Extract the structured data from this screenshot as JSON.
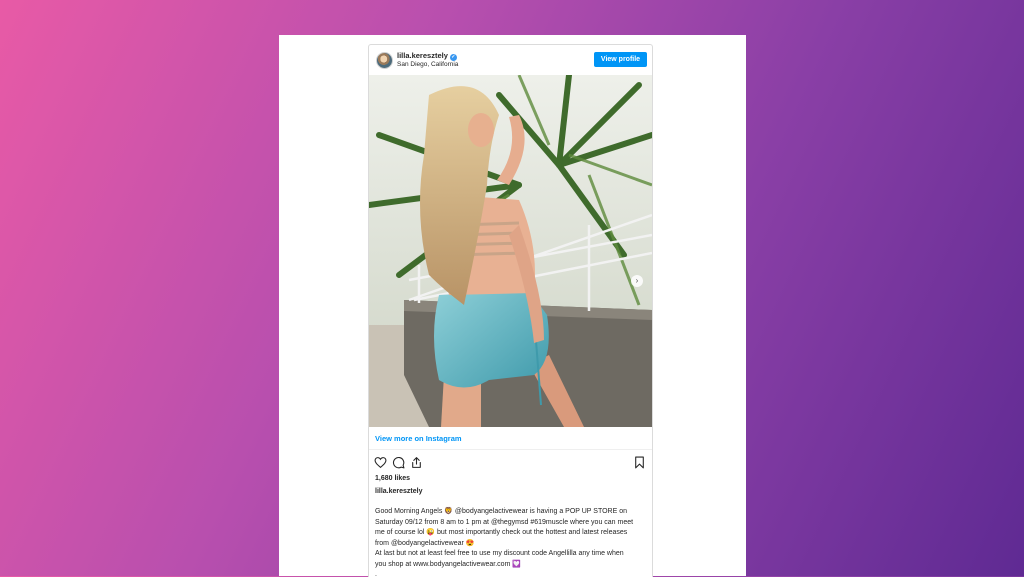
{
  "post": {
    "username": "lilla.keresztely",
    "verified_glyph": "✓",
    "location": "San Diego, California",
    "view_profile_label": "View profile",
    "view_more_label": "View more on Instagram",
    "likes": "1,680 likes",
    "caption_username": "lilla.keresztely",
    "caption_lines": [
      "Good Morning Angels 🦁 @bodyangelactivewear is having a POP UP STORE on",
      "Saturday 09/12 from 8 am to 1 pm at @thegymsd #619muscle where you can meet",
      "me of course lol 😜 but most importantly check out the hottest and latest releases",
      "from @bodyangelactivewear 😍",
      "At last but not at least feel free to use my discount code Angellilla any time when",
      "you shop at www.bodyangelactivewear.com 💟",
      ".",
      "."
    ]
  },
  "icons": {
    "heart": "heart-icon",
    "comment": "comment-icon",
    "share": "share-icon",
    "bookmark": "bookmark-icon",
    "next": "chevron-right-icon",
    "verified": "verified-badge-icon"
  },
  "colors": {
    "accent": "#0095f6",
    "gradient_start": "#e85aa6",
    "gradient_end": "#5f2a93"
  }
}
